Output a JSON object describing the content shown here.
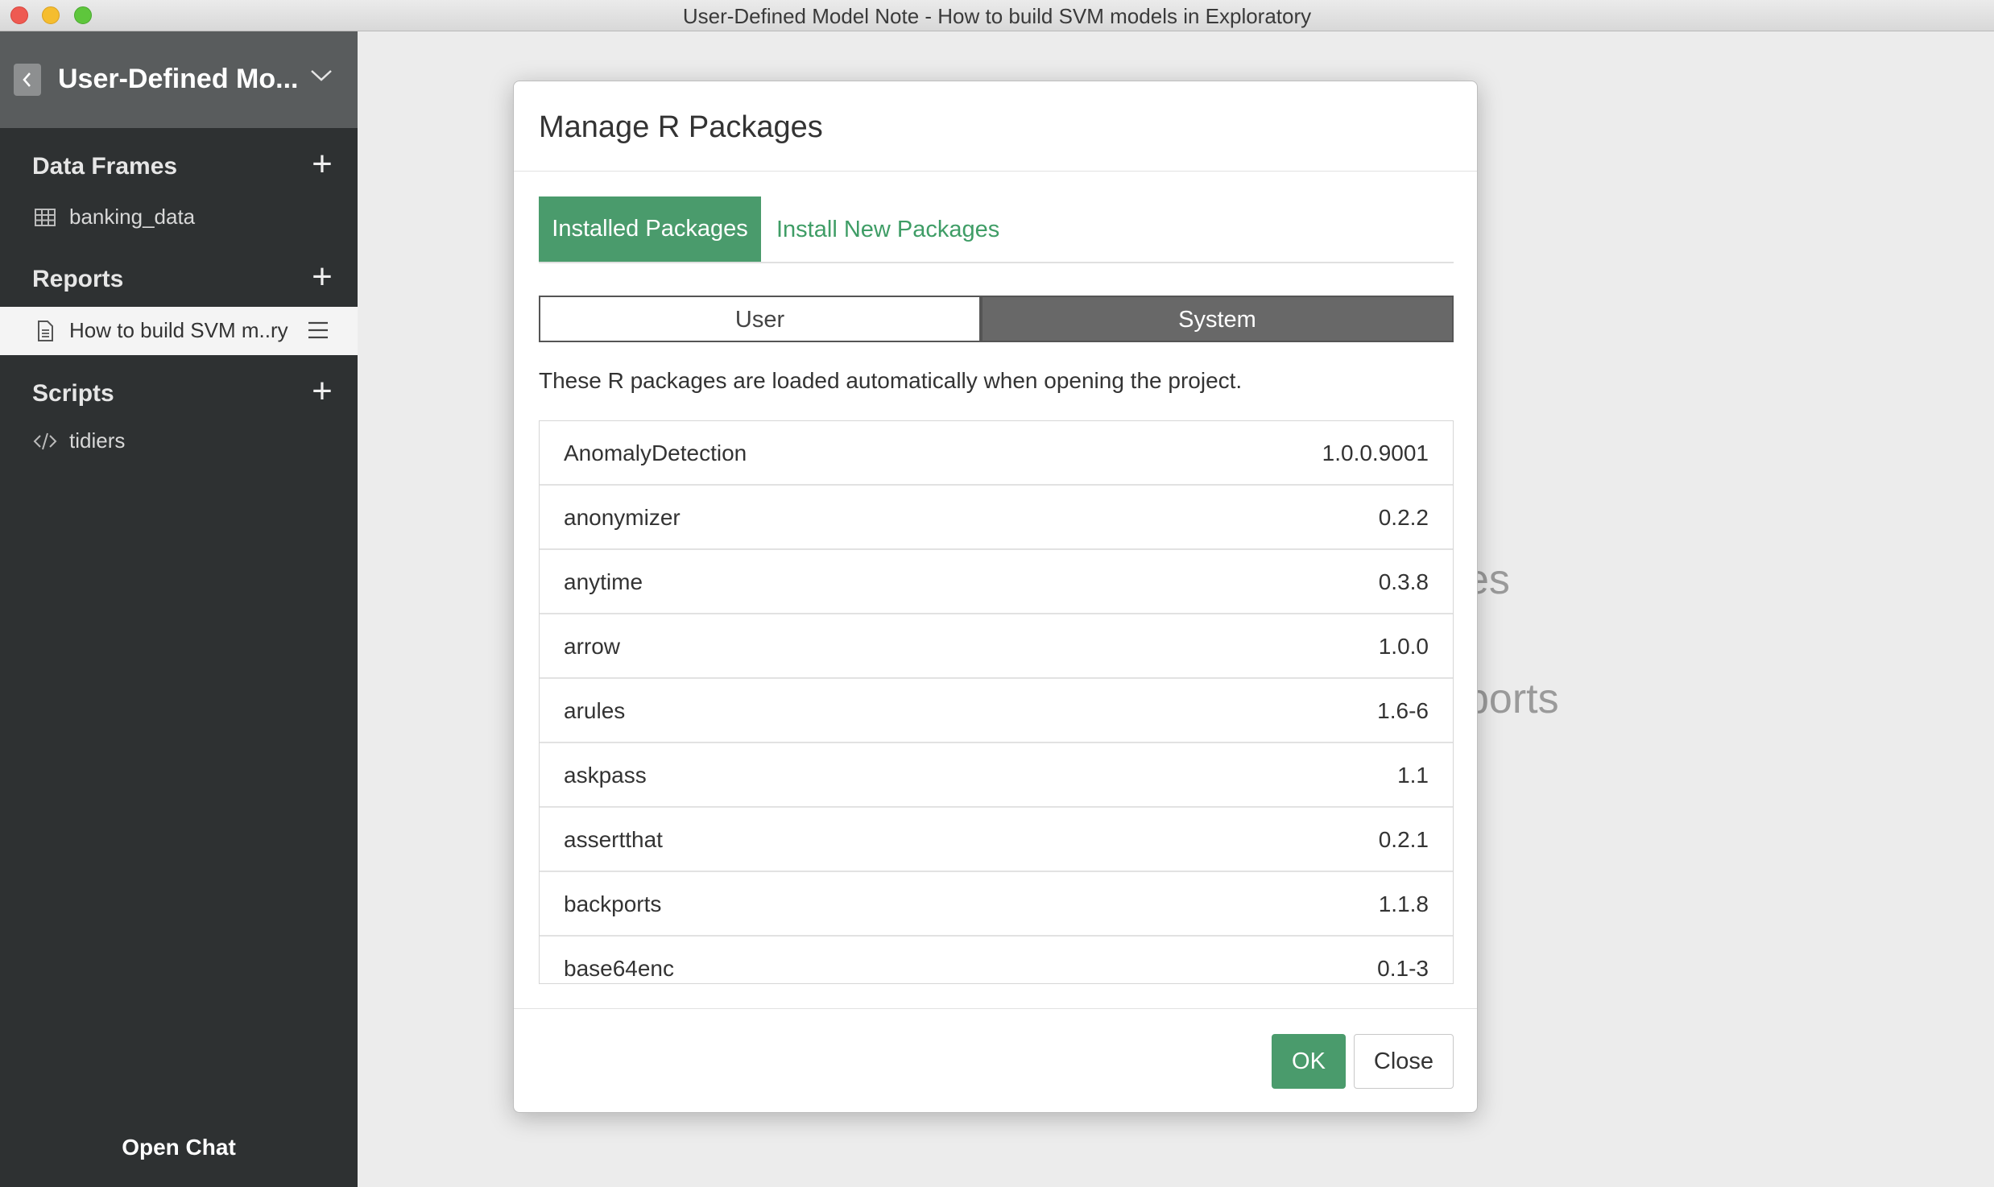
{
  "window": {
    "title": "User-Defined Model Note - How to build SVM models in Exploratory"
  },
  "sidebar": {
    "project_name": "User-Defined Mo...",
    "sections": {
      "data_frames": {
        "title": "Data Frames",
        "items": [
          "banking_data"
        ]
      },
      "reports": {
        "title": "Reports",
        "items": [
          "How to build SVM m..ry"
        ]
      },
      "scripts": {
        "title": "Scripts",
        "items": [
          "tidiers"
        ]
      }
    },
    "open_chat": "Open Chat"
  },
  "background": {
    "frag1": "es",
    "frag2": "ports"
  },
  "dialog": {
    "title": "Manage R Packages",
    "tabs": [
      "Installed Packages",
      "Install New Packages"
    ],
    "active_tab": "Installed Packages",
    "segments": [
      "User",
      "System"
    ],
    "active_segment": "System",
    "description": "These R packages are loaded automatically when opening the project.",
    "packages": [
      {
        "name": "AnomalyDetection",
        "version": "1.0.0.9001"
      },
      {
        "name": "anonymizer",
        "version": "0.2.2"
      },
      {
        "name": "anytime",
        "version": "0.3.8"
      },
      {
        "name": "arrow",
        "version": "1.0.0"
      },
      {
        "name": "arules",
        "version": "1.6-6"
      },
      {
        "name": "askpass",
        "version": "1.1"
      },
      {
        "name": "assertthat",
        "version": "0.2.1"
      },
      {
        "name": "backports",
        "version": "1.1.8"
      },
      {
        "name": "base64enc",
        "version": "0.1-3"
      }
    ],
    "ok_label": "OK",
    "close_label": "Close"
  },
  "colors": {
    "accent_green": "#4a9b6c",
    "sidebar_bg": "#2e3132",
    "sidebar_header_bg": "#595c5d",
    "segment_active_bg": "#686868"
  }
}
